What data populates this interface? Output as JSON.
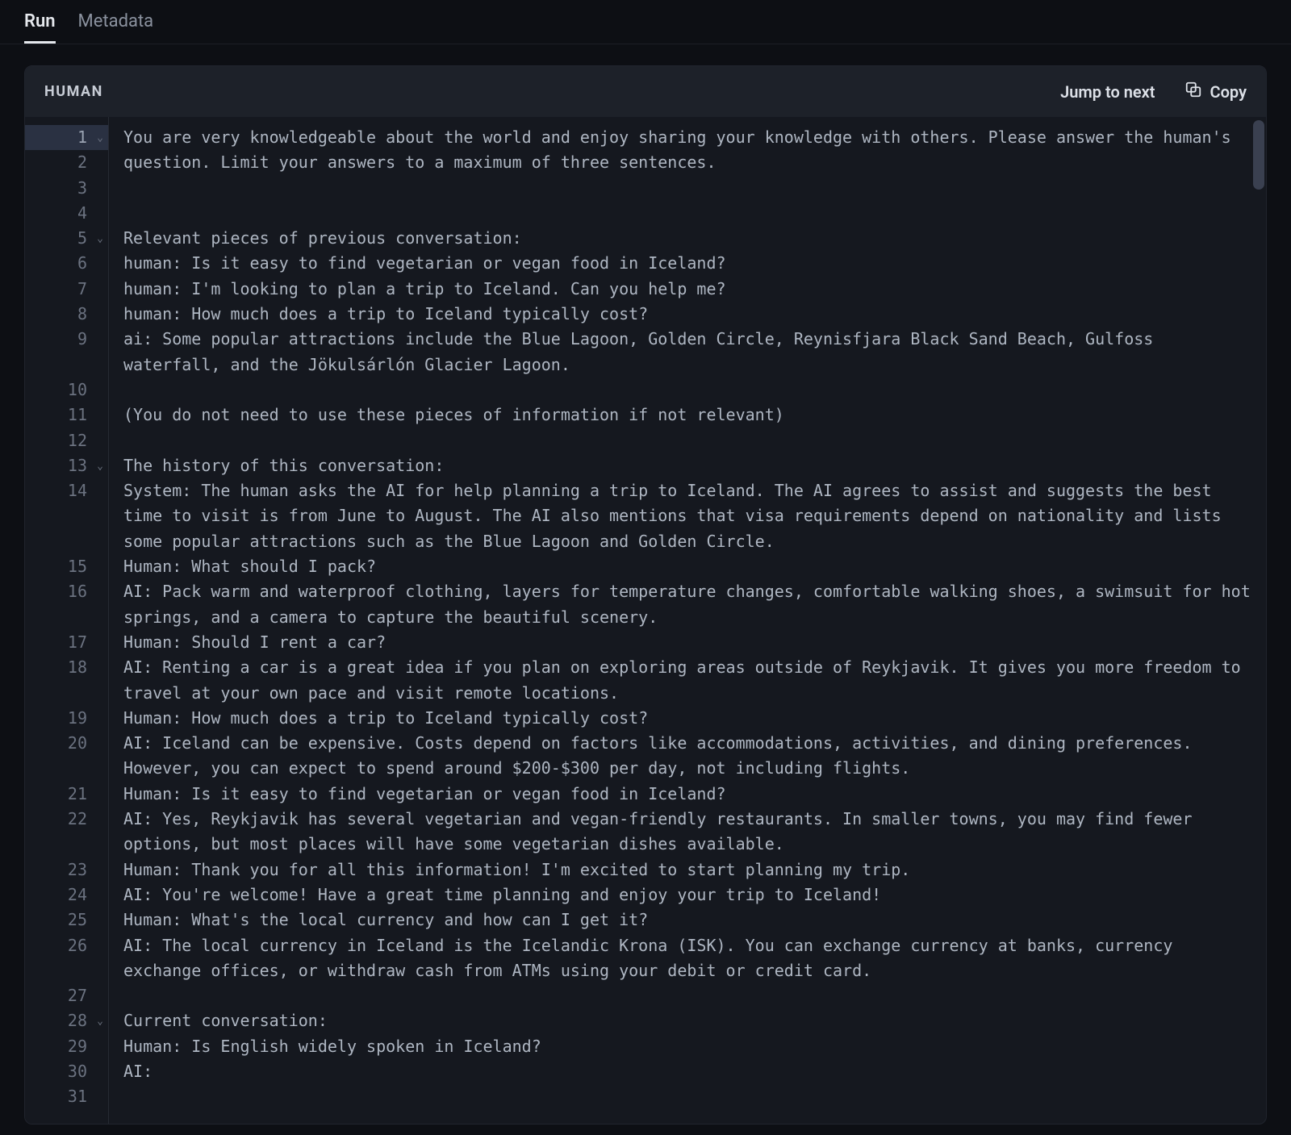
{
  "tabs": {
    "run": "Run",
    "metadata": "Metadata"
  },
  "panel": {
    "title": "HUMAN",
    "jump": "Jump to next",
    "copy": "Copy"
  },
  "code": {
    "lines": [
      {
        "n": "1",
        "fold": true,
        "hl": true,
        "text": "You are very knowledgeable about the world and enjoy sharing your knowledge with others. Please answer the human's question. Limit your answers to a maximum of three sentences.",
        "rows": 3
      },
      {
        "n": "2",
        "skip": true
      },
      {
        "n": "3",
        "skip": true
      },
      {
        "n": "4",
        "text": "",
        "rows": 1
      },
      {
        "n": "5",
        "fold": true,
        "text": "Relevant pieces of previous conversation:",
        "rows": 1
      },
      {
        "n": "6",
        "text": "human: Is it easy to find vegetarian or vegan food in Iceland?",
        "rows": 1
      },
      {
        "n": "7",
        "text": "human: I'm looking to plan a trip to Iceland. Can you help me?",
        "rows": 1
      },
      {
        "n": "8",
        "text": "human: How much does a trip to Iceland typically cost?",
        "rows": 1
      },
      {
        "n": "9",
        "text": "ai: Some popular attractions include the Blue Lagoon, Golden Circle, Reynisfjara Black Sand Beach, Gulfoss waterfall, and the Jökulsárlón Glacier Lagoon.",
        "rows": 2
      },
      {
        "n": "10",
        "text": "",
        "rows": 1
      },
      {
        "n": "11",
        "text": "(You do not need to use these pieces of information if not relevant)",
        "rows": 1
      },
      {
        "n": "12",
        "text": "",
        "rows": 1
      },
      {
        "n": "13",
        "fold": true,
        "text": "The history of this conversation:",
        "rows": 1
      },
      {
        "n": "14",
        "text": "System: The human asks the AI for help planning a trip to Iceland. The AI agrees to assist and suggests the best time to visit is from June to August. The AI also mentions that visa requirements depend on nationality and lists some popular attractions such as the Blue Lagoon and Golden Circle.",
        "rows": 3
      },
      {
        "n": "15",
        "text": "Human: What should I pack?",
        "rows": 1
      },
      {
        "n": "16",
        "text": "AI: Pack warm and waterproof clothing, layers for temperature changes, comfortable walking shoes, a swimsuit for hot springs, and a camera to capture the beautiful scenery.",
        "rows": 2
      },
      {
        "n": "17",
        "text": "Human: Should I rent a car?",
        "rows": 1
      },
      {
        "n": "18",
        "text": "AI: Renting a car is a great idea if you plan on exploring areas outside of Reykjavik. It gives you more freedom to travel at your own pace and visit remote locations.",
        "rows": 2
      },
      {
        "n": "19",
        "text": "Human: How much does a trip to Iceland typically cost?",
        "rows": 1
      },
      {
        "n": "20",
        "text": "AI: Iceland can be expensive. Costs depend on factors like accommodations, activities, and dining preferences. However, you can expect to spend around $200-$300 per day, not including flights.",
        "rows": 2
      },
      {
        "n": "21",
        "text": "Human: Is it easy to find vegetarian or vegan food in Iceland?",
        "rows": 1
      },
      {
        "n": "22",
        "text": "AI: Yes, Reykjavik has several vegetarian and vegan-friendly restaurants. In smaller towns, you may find fewer options, but most places will have some vegetarian dishes available.",
        "rows": 2
      },
      {
        "n": "23",
        "text": "Human: Thank you for all this information! I'm excited to start planning my trip.",
        "rows": 1
      },
      {
        "n": "24",
        "text": "AI: You're welcome! Have a great time planning and enjoy your trip to Iceland!",
        "rows": 1
      },
      {
        "n": "25",
        "text": "Human: What's the local currency and how can I get it?",
        "rows": 1
      },
      {
        "n": "26",
        "text": "AI: The local currency in Iceland is the Icelandic Krona (ISK). You can exchange currency at banks, currency exchange offices, or withdraw cash from ATMs using your debit or credit card.",
        "rows": 2
      },
      {
        "n": "27",
        "text": "",
        "rows": 1
      },
      {
        "n": "28",
        "fold": true,
        "text": "Current conversation:",
        "rows": 1
      },
      {
        "n": "29",
        "text": "Human: Is English widely spoken in Iceland?",
        "rows": 1
      },
      {
        "n": "30",
        "text": "AI:",
        "rows": 1
      },
      {
        "n": "31",
        "text": "",
        "rows": 1
      }
    ]
  },
  "layout": {
    "lineHeight": 31.3
  }
}
